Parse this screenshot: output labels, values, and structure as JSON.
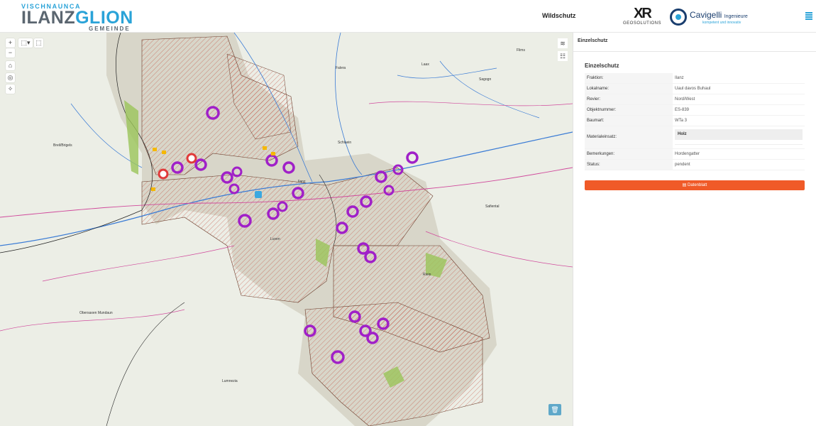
{
  "header": {
    "logo_top": "VISCHNAUNCA",
    "logo_main_a": "ILANZ",
    "logo_main_b": "GLION",
    "logo_bottom": "GEMEINDE",
    "nav_title": "Wildschutz",
    "geo_mark": "XR",
    "geo_text": "GEOSOLUTIONS",
    "cav_name": "Cavigelli",
    "cav_name_small": "Ingenieure",
    "cav_sub": "kompetent und innovativ",
    "menu_icon": "stacked-bars-icon"
  },
  "map": {
    "controls": {
      "zoom_in": "+",
      "zoom_out": "−",
      "home": "⌂",
      "locate": "◎",
      "draw_select": "⬚▾",
      "query": "⬚",
      "layers": "≋",
      "legend": "☷",
      "trash": "🗑"
    },
    "place_labels": [
      {
        "name": "Flims"
      },
      {
        "name": "Laax"
      },
      {
        "name": "Sagogn"
      },
      {
        "name": "Falera"
      },
      {
        "name": "Breil/Brigels"
      },
      {
        "name": "Schluein"
      },
      {
        "name": "Safiental"
      },
      {
        "name": "Obersaxen Mundaun"
      },
      {
        "name": "Lumnezia"
      },
      {
        "name": "Luven"
      },
      {
        "name": "Ilanz"
      },
      {
        "name": "Riein"
      }
    ]
  },
  "panel": {
    "header": "Einzelschutz",
    "section_title": "Einzelschutz",
    "rows": [
      {
        "key": "Fraktion:",
        "value": "Ilanz"
      },
      {
        "key": "Lokalname:",
        "value": "Uaul davos Buhaul"
      },
      {
        "key": "Revier:",
        "value": "Nord/West"
      },
      {
        "key": "Objektnummer:",
        "value": "ES-839"
      },
      {
        "key": "Baumart:",
        "value": "WTa 3"
      }
    ],
    "material_key": "Materialeinsatz:",
    "material_value": "Holz",
    "rows2": [
      {
        "key": "Bemerkungen:",
        "value": "Hordengatter"
      },
      {
        "key": "Status:",
        "value": "pendent"
      }
    ],
    "button_label": "Datenblatt",
    "button_icon": "document-icon"
  },
  "colors": {
    "accent": "#2aa3d8",
    "button": "#f05a28",
    "marker": "#a020c8",
    "marker_red": "#e03a3a",
    "hatch": "#c0392b"
  }
}
